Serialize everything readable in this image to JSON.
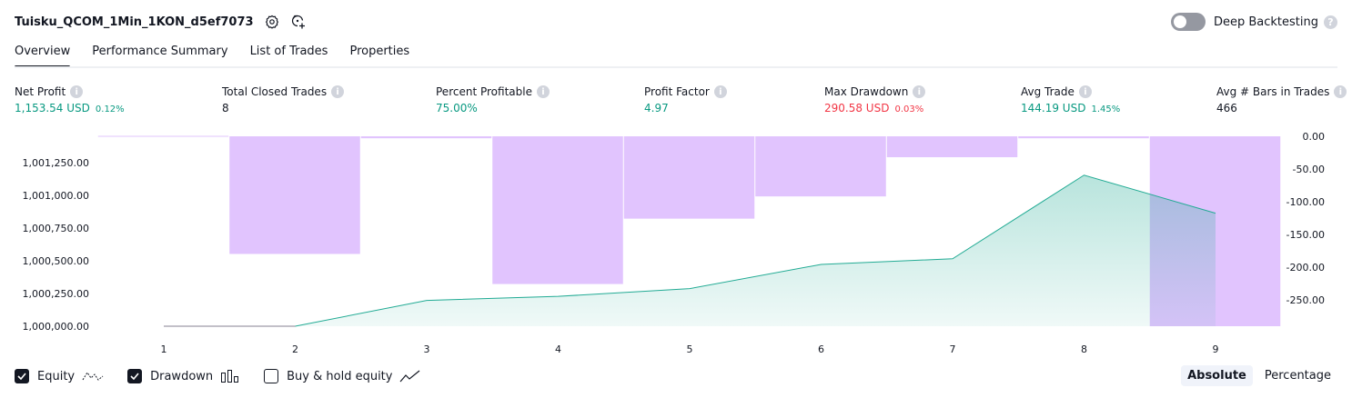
{
  "header": {
    "strategy_name": "Tuisku_QCOM_1Min_1KON_d5ef7073",
    "deep_backtesting_label": "Deep Backtesting",
    "help_glyph": "?"
  },
  "tabs": [
    {
      "label": "Overview",
      "active": true
    },
    {
      "label": "Performance Summary",
      "active": false
    },
    {
      "label": "List of Trades",
      "active": false
    },
    {
      "label": "Properties",
      "active": false
    }
  ],
  "stats": [
    {
      "label": "Net Profit",
      "value": "1,153.54 USD",
      "sub": "0.12%",
      "color": "green"
    },
    {
      "label": "Total Closed Trades",
      "value": "8",
      "sub": "",
      "color": "dark"
    },
    {
      "label": "Percent Profitable",
      "value": "75.00%",
      "sub": "",
      "color": "green"
    },
    {
      "label": "Profit Factor",
      "value": "4.97",
      "sub": "",
      "color": "green"
    },
    {
      "label": "Max Drawdown",
      "value": "290.58 USD",
      "sub": "0.03%",
      "color": "red"
    },
    {
      "label": "Avg Trade",
      "value": "144.19 USD",
      "sub": "1.45%",
      "color": "green"
    },
    {
      "label": "Avg # Bars in Trades",
      "value": "466",
      "sub": "",
      "color": "dark"
    }
  ],
  "stat_info_glyph": "i",
  "chart_data": {
    "type": "area",
    "x": [
      1,
      2,
      3,
      4,
      5,
      6,
      7,
      8,
      9
    ],
    "series": [
      {
        "name": "Equity",
        "axis": "left",
        "values": [
          1000000.0,
          1000000.0,
          1000197.0,
          1000228.0,
          1000287.0,
          1000472.0,
          1000515.0,
          1001153.54,
          1000863.0
        ],
        "color": "#22ab94"
      },
      {
        "name": "Drawdown",
        "axis": "right",
        "type": "bar",
        "values": [
          0,
          -180.0,
          -3.0,
          -226.0,
          -126.0,
          -92.0,
          -32.0,
          -3.0,
          -290.58
        ],
        "color": "#e1c4fe"
      }
    ],
    "left_ticks": [
      "1,000,000.00",
      "1,000,250.00",
      "1,000,500.00",
      "1,000,750.00",
      "1,001,000.00",
      "1,001,250.00"
    ],
    "left_tick_values": [
      1000000,
      1000250,
      1000500,
      1000750,
      1001000,
      1001250
    ],
    "right_ticks": [
      "0.00",
      "-50.00",
      "-100.00",
      "-150.00",
      "-200.00",
      "-250.00"
    ],
    "right_tick_values": [
      0,
      -50,
      -100,
      -150,
      -200,
      -250
    ],
    "x_ticks": [
      "1",
      "2",
      "3",
      "4",
      "5",
      "6",
      "7",
      "8",
      "9"
    ],
    "left_range": [
      1000000,
      1001450
    ],
    "right_range": [
      -290.58,
      0
    ],
    "grid": false
  },
  "legend": [
    {
      "label": "Equity",
      "checked": true,
      "icon": "equity-line-icon"
    },
    {
      "label": "Drawdown",
      "checked": true,
      "icon": "drawdown-bars-icon"
    },
    {
      "label": "Buy & hold equity",
      "checked": false,
      "icon": "buy-hold-line-icon"
    }
  ],
  "modes": [
    {
      "label": "Absolute",
      "active": true
    },
    {
      "label": "Percentage",
      "active": false
    }
  ]
}
